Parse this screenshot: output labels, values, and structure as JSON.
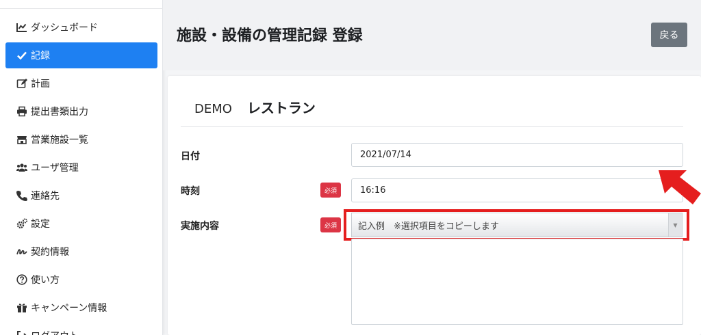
{
  "sidebar": {
    "items": [
      {
        "label": "ダッシュボード",
        "icon": "chart-line-icon",
        "active": false
      },
      {
        "label": "記録",
        "icon": "check-icon",
        "active": true
      },
      {
        "label": "計画",
        "icon": "edit-icon",
        "active": false
      },
      {
        "label": "提出書類出力",
        "icon": "printer-icon",
        "active": false
      },
      {
        "label": "営業施設一覧",
        "icon": "store-icon",
        "active": false
      },
      {
        "label": "ユーザ管理",
        "icon": "users-icon",
        "active": false
      },
      {
        "label": "連絡先",
        "icon": "phone-icon",
        "active": false
      },
      {
        "label": "設定",
        "icon": "gears-icon",
        "active": false
      },
      {
        "label": "契約情報",
        "icon": "signature-icon",
        "active": false
      },
      {
        "label": "使い方",
        "icon": "question-circle-icon",
        "active": false
      },
      {
        "label": "キャンペーン情報",
        "icon": "gift-icon",
        "active": false
      },
      {
        "label": "ログアウト",
        "icon": "logout-icon",
        "active": false
      }
    ]
  },
  "header": {
    "title": "施設・設備の管理記録 登録",
    "back_label": "戻る"
  },
  "store": {
    "code": "DEMO",
    "name": "レストラン"
  },
  "form": {
    "date": {
      "label": "日付",
      "value": "2021/07/14"
    },
    "time": {
      "label": "時刻",
      "value": "16:16",
      "required_badge": "必須"
    },
    "content": {
      "label": "実施内容",
      "select_value": "記入例　※選択項目をコピーします",
      "required_badge": "必須"
    }
  },
  "colors": {
    "accent": "#1e80f2",
    "required": "#dc3545",
    "annotation": "#e51e1e",
    "back_button": "#6c757d"
  }
}
